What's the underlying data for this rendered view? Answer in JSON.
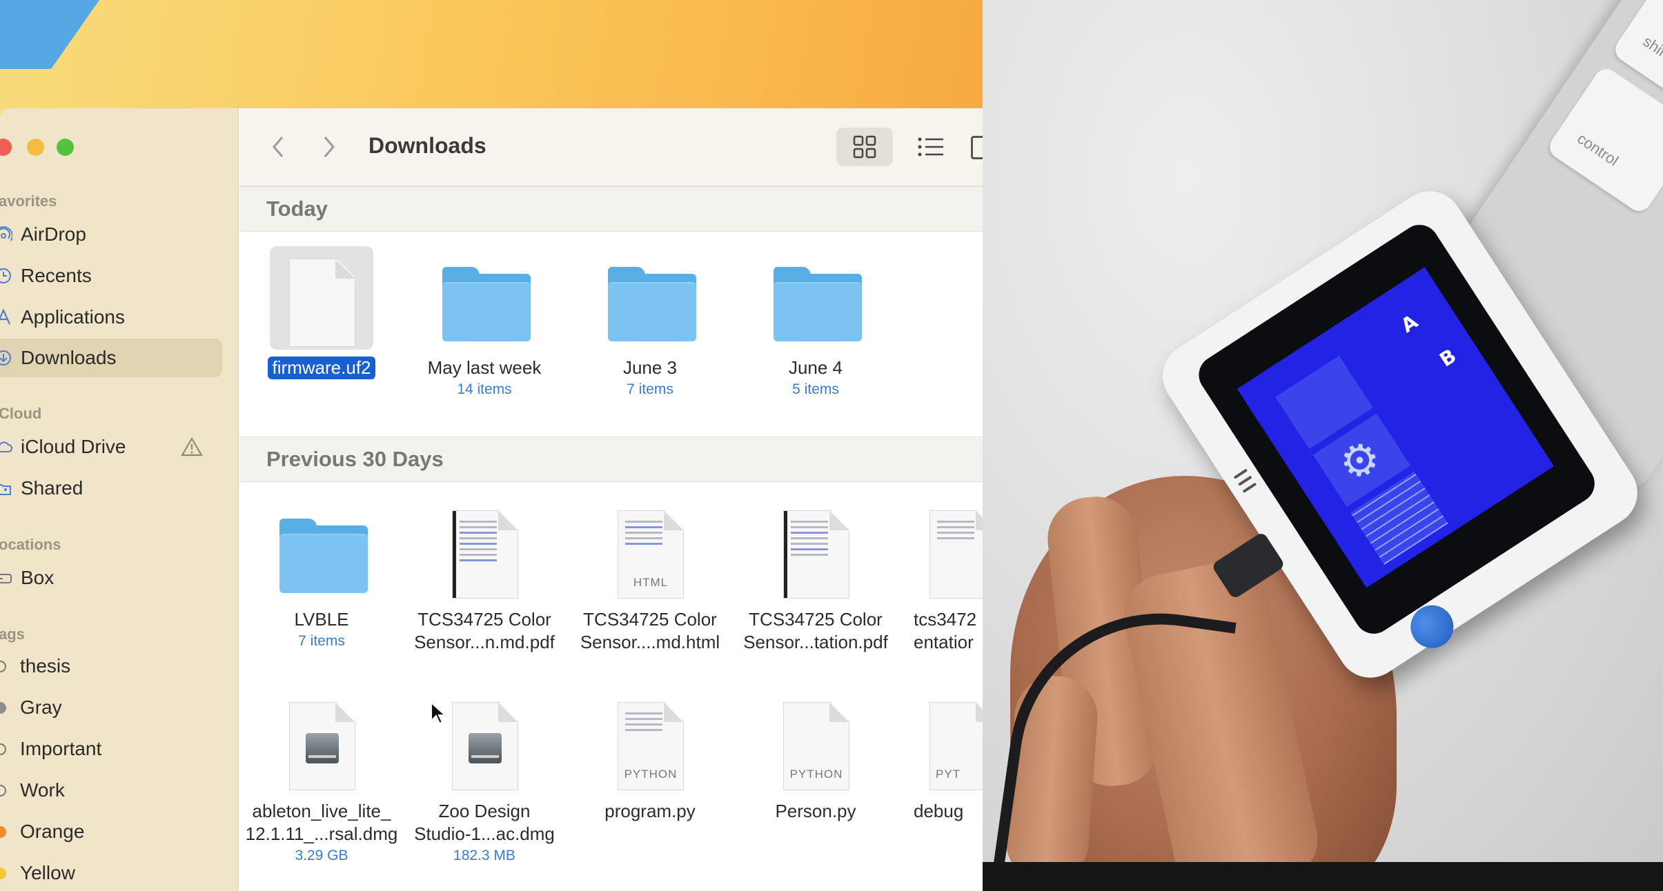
{
  "window": {
    "title": "Downloads"
  },
  "sidebar": {
    "sections": [
      {
        "label": "avorites"
      },
      {
        "label": "Cloud"
      },
      {
        "label": "ocations"
      },
      {
        "label": "ags"
      }
    ],
    "favorites": [
      {
        "label": "AirDrop",
        "icon": "airdrop-icon"
      },
      {
        "label": "Recents",
        "icon": "clock-icon"
      },
      {
        "label": "Applications",
        "icon": "applications-icon"
      },
      {
        "label": "Downloads",
        "icon": "download-icon",
        "selected": true
      }
    ],
    "icloud": [
      {
        "label": "iCloud Drive",
        "icon": "cloud-icon"
      },
      {
        "label": "Shared",
        "icon": "shared-folder-icon"
      }
    ],
    "locations": [
      {
        "label": "Box",
        "icon": "drive-icon"
      }
    ],
    "tags": [
      {
        "label": "thesis",
        "color": "#777777"
      },
      {
        "label": "Gray",
        "color": "#8e8e8e"
      },
      {
        "label": "Important",
        "color": "#777777"
      },
      {
        "label": "Work",
        "color": "#777777"
      },
      {
        "label": "Orange",
        "color": "#f08a2c"
      },
      {
        "label": "Yellow",
        "color": "#f5c631"
      }
    ]
  },
  "groups": [
    {
      "title": "Today",
      "items": [
        {
          "name": "firmware.uf2",
          "meta": "",
          "kind": "document",
          "selected": true
        },
        {
          "name": "May last week",
          "meta": "14 items",
          "kind": "folder"
        },
        {
          "name": "June 3",
          "meta": "7 items",
          "kind": "folder"
        },
        {
          "name": "June 4",
          "meta": "5 items",
          "kind": "folder"
        }
      ]
    },
    {
      "title": "Previous 30 Days",
      "items": [
        {
          "name": "LVBLE",
          "meta": "7 items",
          "kind": "folder"
        },
        {
          "name": "TCS34725 Color\nSensor...n.md.pdf",
          "meta": "",
          "kind": "pdf"
        },
        {
          "name": "TCS34725 Color\nSensor....md.html",
          "meta": "",
          "kind": "html",
          "badge": "HTML"
        },
        {
          "name": "TCS34725 Color\nSensor...tation.pdf",
          "meta": "",
          "kind": "pdf"
        },
        {
          "name": "tcs3472\nentatior",
          "meta": "",
          "kind": "pdf"
        },
        {
          "name": "ableton_live_lite_\n12.1.11_...rsal.dmg",
          "meta": "3.29 GB",
          "kind": "dmg"
        },
        {
          "name": "Zoo Design\nStudio-1...ac.dmg",
          "meta": "182.3 MB",
          "kind": "dmg"
        },
        {
          "name": "program.py",
          "meta": "",
          "kind": "python",
          "badge": "PYTHON"
        },
        {
          "name": "Person.py",
          "meta": "",
          "kind": "python",
          "badge": "PYTHON"
        },
        {
          "name": "debug",
          "meta": "",
          "kind": "python",
          "badge": "PYT"
        }
      ]
    }
  ],
  "photo": {
    "keyboard_keys": [
      "shift",
      "control"
    ],
    "screen_letters": [
      "A",
      "B"
    ],
    "screen_color": "#2323e6"
  }
}
